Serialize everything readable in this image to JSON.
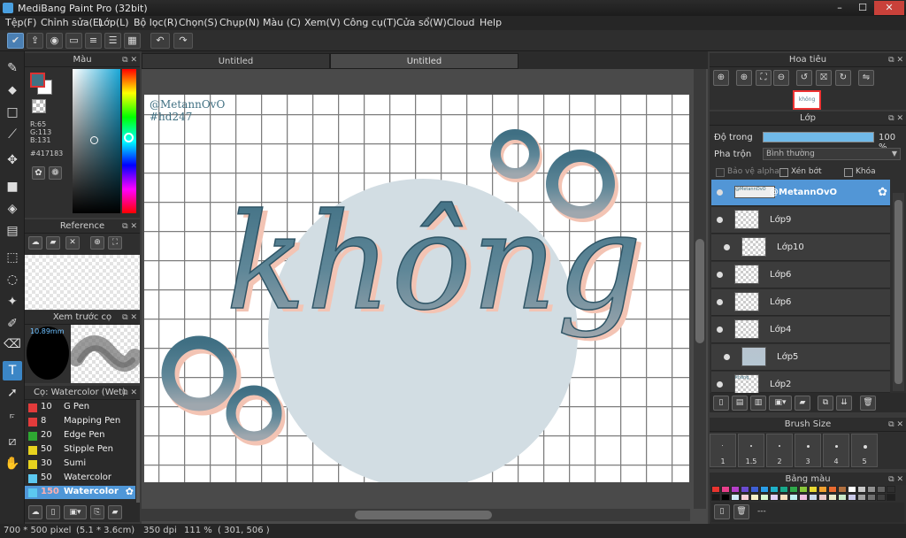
{
  "titlebar": {
    "title": "MediBang Paint Pro (32bit)",
    "min": "–",
    "max": "☐",
    "close": "✕"
  },
  "menu": [
    "Tệp(F)",
    "Chỉnh sửa(E)",
    "Lớp(L)",
    "Bộ lọc(R)",
    "Chọn(S)",
    "Chụp(N)",
    "Màu (C)",
    "Xem(V)",
    "Công cụ(T)",
    "Cửa sổ(W)",
    "Cloud",
    "Help"
  ],
  "toolbar": {
    "icons": [
      "sync-icon",
      "share-icon",
      "chat-icon",
      "comment-icon",
      "page-list-icon",
      "page-manage-icon",
      "panel-grid-icon"
    ],
    "undo": "↶",
    "redo": "↷"
  },
  "tools": [
    "brush-icon",
    "eraser-icon",
    "rectangle-icon",
    "pen-line-icon",
    "move-icon",
    "fill-rect-icon",
    "bucket-icon",
    "gradient-icon",
    "marquee-icon",
    "lasso-icon",
    "magic-wand-icon",
    "select-pen-icon",
    "select-eraser-icon",
    "text-icon",
    "operation-icon",
    "eyedropper-icon",
    "divide-icon",
    "hand-icon"
  ],
  "color_panel": {
    "title": "Màu",
    "r": "R:65",
    "g": "G:113",
    "b": "B:131",
    "hex": "#417183",
    "main_color": "#417183"
  },
  "reference": {
    "title": "Reference"
  },
  "brush_preview": {
    "title": "Xem trước cọ",
    "size": "10.89mm"
  },
  "brush_panel": {
    "title": "Cọ: Watercolor (Wet)",
    "items": [
      {
        "color": "#e23b3b",
        "size": "10",
        "name": "G Pen"
      },
      {
        "color": "#e23b3b",
        "size": "8",
        "name": "Mapping Pen"
      },
      {
        "color": "#2ea832",
        "size": "20",
        "name": "Edge Pen"
      },
      {
        "color": "#e7d21e",
        "size": "50",
        "name": "Stipple Pen"
      },
      {
        "color": "#e7d21e",
        "size": "30",
        "name": "Sumi"
      },
      {
        "color": "#5cc8f0",
        "size": "50",
        "name": "Watercolor"
      },
      {
        "color": "#5cc8f0",
        "size": "150",
        "name": "Watercolor"
      }
    ]
  },
  "tabs": [
    "Untitled",
    "Untitled"
  ],
  "canvas": {
    "sig1": "@MetannOvO",
    "sig2": "#hd247",
    "word": "không"
  },
  "navigator": {
    "title": "Hoa tiêu",
    "thumb": "không"
  },
  "layer_panel": {
    "title": "Lớp",
    "opacity_label": "Độ trong",
    "opacity_value": "100 %",
    "opacity": 1.0,
    "blend_label": "Pha trộn",
    "blend_value": "Bình thường",
    "protect_alpha": "Bảo vệ alpha",
    "clipping": "Xén bớt",
    "lock": "Khóa",
    "layers": [
      {
        "name": "@MetannOvO",
        "thumb": "@MetannOvO"
      },
      {
        "name": "Lớp9"
      },
      {
        "name": "Lớp10"
      },
      {
        "name": "Lớp6"
      },
      {
        "name": "Lớp6"
      },
      {
        "name": "Lớp4"
      },
      {
        "name": "Lớp5"
      },
      {
        "name": "Lớp2",
        "thumb": "không"
      }
    ]
  },
  "brush_size": {
    "title": "Brush Size",
    "sizes": [
      "1",
      "1.5",
      "2",
      "3",
      "4",
      "5"
    ]
  },
  "palette": {
    "title": "Bảng màu",
    "label": "---",
    "colors": [
      "#e8342f",
      "#e83f8a",
      "#b43fc8",
      "#6a4bd0",
      "#3e5fd4",
      "#2a9ee8",
      "#1fb0c8",
      "#18a88a",
      "#2fa84a",
      "#8ac83a",
      "#e8d832",
      "#f0a030",
      "#e86a30",
      "#b07040",
      "#ffffff",
      "#c8c8c8",
      "#909090",
      "#606060",
      "#303030",
      "#1a1a1a",
      "#000000",
      "#d0e8f8",
      "#f8d0d8",
      "#f8f0c8",
      "#d8f8d0",
      "#e0d0f8",
      "#f8e0c0",
      "#c0f0f0",
      "#f0c0e0",
      "#c8d8e8",
      "#e8c8c8",
      "#e8e8c8",
      "#c8e8c8",
      "#c8c8e8",
      "#a0a0a0",
      "#707070",
      "#404040",
      "#202020"
    ]
  },
  "status": {
    "size": "700 * 500 pixel",
    "cm": "(5.1 * 3.6cm)",
    "dpi": "350 dpi",
    "zoom": "111 %",
    "coords": "( 301, 506 )"
  },
  "colors": {
    "accent": "#5296d6",
    "ink": "#417183"
  }
}
